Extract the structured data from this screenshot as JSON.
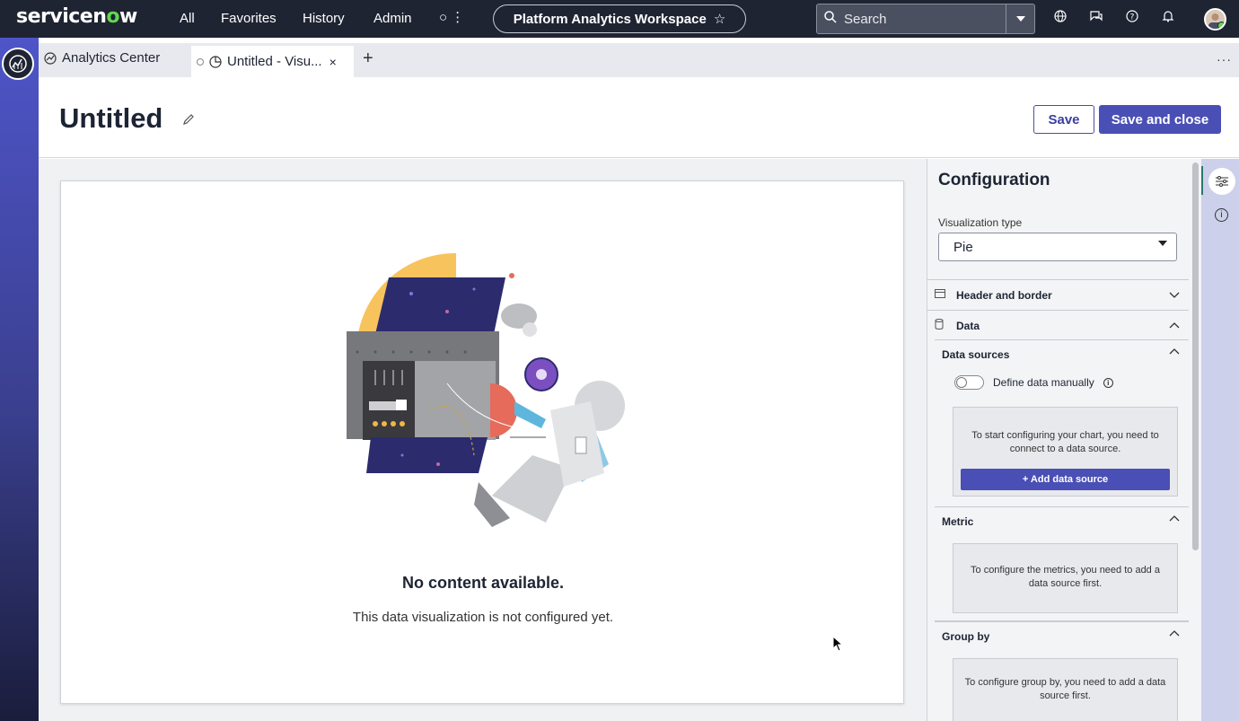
{
  "nav": {
    "logo_left": "servicen",
    "logo_o": "o",
    "logo_right": "w",
    "links": [
      "All",
      "Favorites",
      "History",
      "Admin"
    ],
    "more": "○ ⋮",
    "workspace": "Platform Analytics Workspace",
    "search_placeholder": "Search"
  },
  "tabs": {
    "analytics": "Analytics Center",
    "untitled": "Untitled - Visu...",
    "close": "×",
    "new": "+",
    "more": "···"
  },
  "header": {
    "title": "Untitled",
    "save": "Save",
    "save_close": "Save and close"
  },
  "empty": {
    "title": "No content available.",
    "subtitle": "This data visualization is not configured yet."
  },
  "config": {
    "title": "Configuration",
    "vt_label": "Visualization type",
    "vt_value": "Pie",
    "header_border": "Header and border",
    "data": "Data",
    "data_sources": "Data sources",
    "define_manual": "Define data manually",
    "ds_msg": "To start configuring your chart, you need to connect to a data source.",
    "add_ds": "+ Add data source",
    "metric": "Metric",
    "metric_msg": "To configure the metrics, you need to add a data source first.",
    "group_by": "Group by",
    "group_msg": "To configure group by, you need to add a data source first."
  },
  "colors": {
    "nav_bg": "#1f2433",
    "accent": "#4a4fb5",
    "brand_green": "#62d84e"
  }
}
